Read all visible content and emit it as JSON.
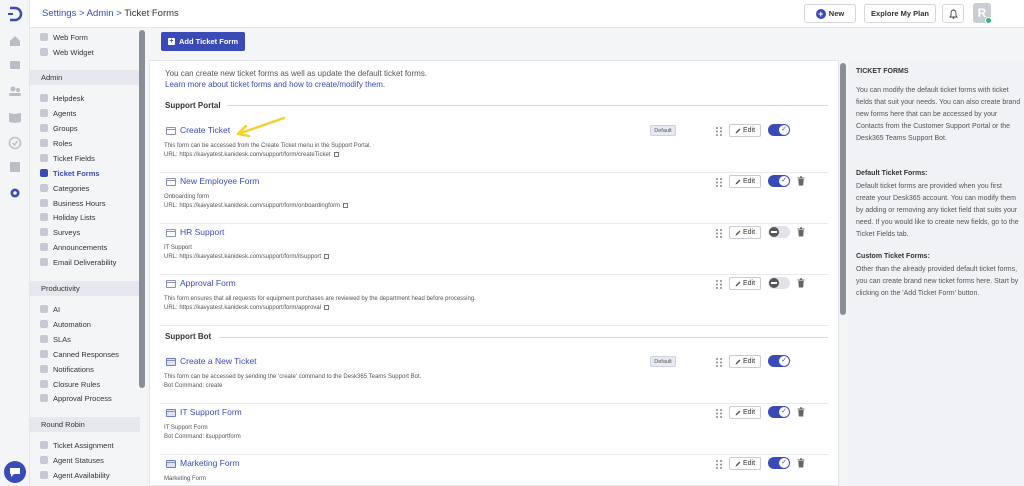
{
  "header": {
    "breadcrumb": {
      "settings": "Settings",
      "sep1": " > ",
      "admin": "Admin",
      "sep2": " > ",
      "current": "Ticket Forms"
    },
    "new_label": "New",
    "explore_label": "Explore My Plan",
    "avatar_initial": "R"
  },
  "sidebar": {
    "top_items": [
      "Web Form",
      "Web Widget"
    ],
    "admin_section": "Admin",
    "admin_items": [
      "Helpdesk",
      "Agents",
      "Groups",
      "Roles",
      "Ticket Fields",
      "Ticket Forms",
      "Categories",
      "Business Hours",
      "Holiday Lists",
      "Surveys",
      "Announcements",
      "Email Deliverability"
    ],
    "active_item": "Ticket Forms",
    "productivity_section": "Productivity",
    "productivity_items": [
      "AI",
      "Automation",
      "SLAs",
      "Canned Responses",
      "Notifications",
      "Closure Rules",
      "Approval Process"
    ],
    "round_robin_section": "Round Robin",
    "round_robin_items": [
      "Ticket Assignment",
      "Agent Statuses",
      "Agent Availability"
    ]
  },
  "main": {
    "add_button": "Add Ticket Form",
    "intro": "You can create new ticket forms as well as update the default ticket forms.",
    "learn_more": "Learn more about ticket forms and how to create/modify them.",
    "edit_label": "Edit",
    "default_label": "Default",
    "portal_section": "Support Portal",
    "bot_section": "Support Bot",
    "portal_forms": [
      {
        "name": "Create Ticket",
        "desc": "This form can be accessed from the Create Ticket menu in the Support Portal.",
        "url": "URL: https://kavyatest.kanidesk.com/support/form/createTicket",
        "default": true,
        "enabled": true
      },
      {
        "name": "New Employee Form",
        "desc": "Onboarding form",
        "url": "URL: https://kavyatest.kanidesk.com/support/form/onboardingform",
        "default": false,
        "enabled": true
      },
      {
        "name": "HR Support",
        "desc": "IT Support",
        "url": "URL: https://kavyatest.kanidesk.com/support/form/itsupport",
        "default": false,
        "enabled": false
      },
      {
        "name": "Approval Form",
        "desc": "This form ensures that all requests for equipment purchases are reviewed by the department head before processing.",
        "url": "URL: https://kavyatest.kanidesk.com/support/form/approval",
        "default": false,
        "enabled": false
      }
    ],
    "bot_forms": [
      {
        "name": "Create a New Ticket",
        "desc": "This form can be accessed by sending the 'create' command to the Desk365 Teams Support Bot.",
        "command": "Bot Command: create",
        "default": true,
        "enabled": true
      },
      {
        "name": "IT Support Form",
        "desc": "IT Support Form",
        "command": "Bot Command: itsupportform",
        "default": false,
        "enabled": true
      },
      {
        "name": "Marketing Form",
        "desc": "Marketing Form",
        "command": "",
        "default": false,
        "enabled": true
      }
    ]
  },
  "info_panel": {
    "title": "TICKET FORMS",
    "intro": "You can modify the default ticket forms with ticket fields that suit your needs. You can also create brand new forms here that can be accessed by your Contacts from the Customer Support Portal or the Desk365 Teams Support Bot.",
    "default_title": "Default Ticket Forms:",
    "default_text": "Default ticket forms are provided when you first create your Desk365 account. You can modify them by adding or removing any ticket field that suits your need. If you would like to create new fields, go to the Ticket Fields tab.",
    "custom_title": "Custom Ticket Forms:",
    "custom_text": "Other than the already provided default ticket forms, you can create brand new ticket forms here. Start by clicking on the 'Add Ticket Form' button."
  },
  "colors": {
    "accent": "#3a4bb8",
    "annotation_arrow": "#f5d02a",
    "status_online": "#2eb872"
  }
}
